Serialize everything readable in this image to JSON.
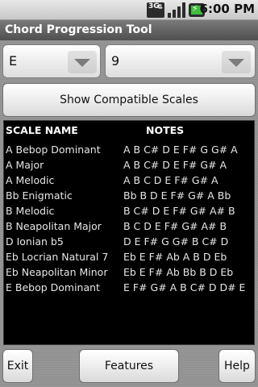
{
  "status_bar": {
    "network_label": "3G",
    "network_icon": "3g-data-icon",
    "signal_icon": "signal-strength-icon",
    "battery_icon": "battery-charging-icon",
    "time": "6:00 PM"
  },
  "app": {
    "title": "Chord Progression Tool"
  },
  "selectors": {
    "key": {
      "value": "E",
      "icon": "dropdown-arrow-icon"
    },
    "chord": {
      "value": "9",
      "icon": "dropdown-arrow-icon"
    }
  },
  "actions": {
    "show_label": "Show Compatible Scales"
  },
  "scale_list": {
    "columns": [
      "SCALE NAME",
      "NOTES"
    ],
    "rows": [
      {
        "name": "A Bebop Dominant",
        "notes": "A B C# D E F# G G# A"
      },
      {
        "name": "A Major",
        "notes": "A B C# D E F# G# A"
      },
      {
        "name": "A Melodic",
        "notes": "A B C D E F# G# A"
      },
      {
        "name": "Bb Enigmatic",
        "notes": "Bb B D E F# G# A Bb"
      },
      {
        "name": "B Melodic",
        "notes": "B C# D E F# G# A# B"
      },
      {
        "name": "B Neapolitan Major",
        "notes": "B C D E F# G# A# B"
      },
      {
        "name": "D Ionian b5",
        "notes": "D E F# G G# B C# D"
      },
      {
        "name": "Eb Locrian Natural 7",
        "notes": "Eb E F# Ab A B D Eb"
      },
      {
        "name": "Eb Neapolitan Minor",
        "notes": "Eb E F# Ab Bb B D Eb"
      },
      {
        "name": "E Bebop Dominant",
        "notes": "E F# G# A B C# D D# E"
      }
    ]
  },
  "bottom_bar": {
    "exit_label": "Exit",
    "features_label": "Features",
    "help_label": "Help"
  }
}
